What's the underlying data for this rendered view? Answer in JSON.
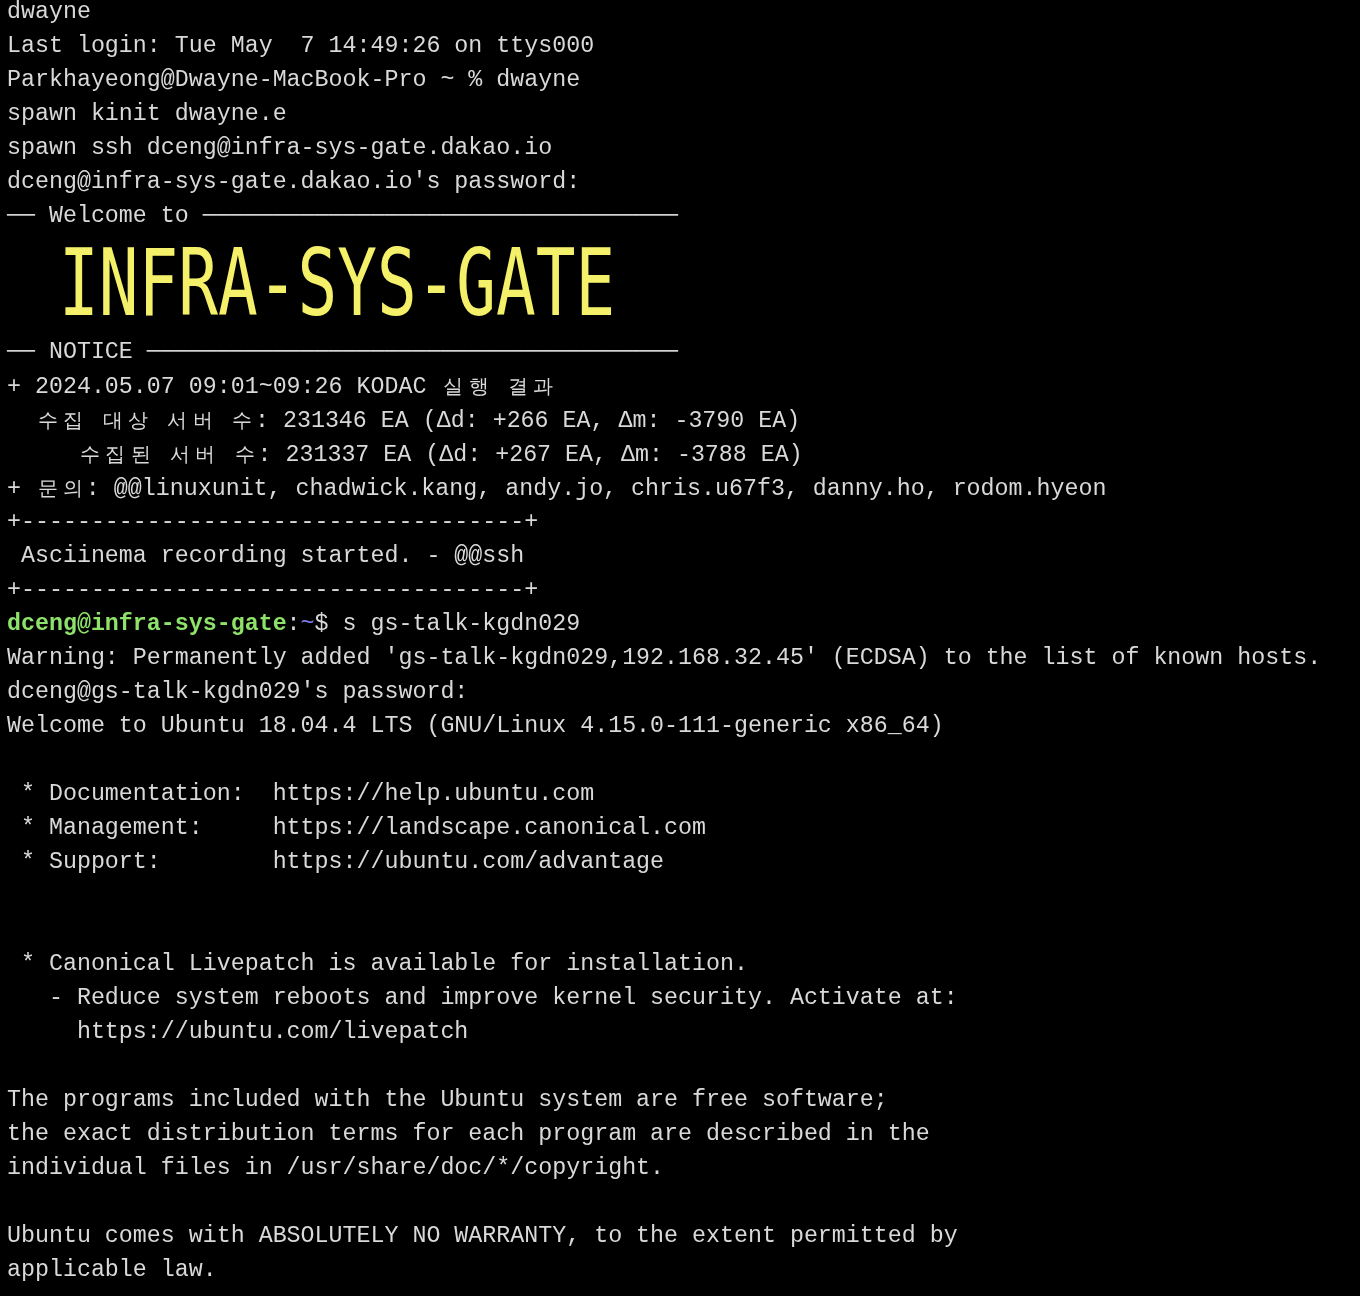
{
  "lines": [
    {
      "kind": "text",
      "text": "dwayne"
    },
    {
      "kind": "text",
      "text": "Last login: Tue May  7 14:49:26 on ttys000"
    },
    {
      "kind": "text",
      "text": "Parkhayeong@Dwayne-MacBook-Pro ~ % dwayne"
    },
    {
      "kind": "text",
      "text": "spawn kinit dwayne.e"
    },
    {
      "kind": "text",
      "text": "spawn ssh dceng@infra-sys-gate.dakao.io"
    },
    {
      "kind": "text",
      "text": "dceng@infra-sys-gate.dakao.io's password:"
    },
    {
      "kind": "text",
      "text": "── Welcome to ──────────────────────────────────"
    },
    {
      "kind": "banner",
      "text": "INFRA-SYS-GATE"
    },
    {
      "kind": "text",
      "text": "── NOTICE ──────────────────────────────────────"
    },
    {
      "kind": "text",
      "text": "+ 2024.05.07 09:01~09:26 KODAC 실행 결과"
    },
    {
      "kind": "text",
      "text": "  수집 대상 서버 수: 231346 EA (Δd: +266 EA, Δm: -3790 EA)"
    },
    {
      "kind": "text",
      "text": "     수집된 서버 수: 231337 EA (Δd: +267 EA, Δm: -3788 EA)"
    },
    {
      "kind": "text",
      "text": "+ 문의: @@linuxunit, chadwick.kang, andy.jo, chris.u67f3, danny.ho, rodom.hyeon"
    },
    {
      "kind": "text",
      "text": "+------------------------------------+"
    },
    {
      "kind": "text",
      "text": " Asciinema recording started. - @@ssh"
    },
    {
      "kind": "text",
      "text": "+------------------------------------+"
    },
    {
      "kind": "prompt",
      "user": "dceng@infra-sys-gate",
      "separator": ":",
      "path": "~",
      "command": "$ s gs-talk-kgdn029"
    },
    {
      "kind": "text",
      "text": "Warning: Permanently added 'gs-talk-kgdn029,192.168.32.45' (ECDSA) to the list of known hosts."
    },
    {
      "kind": "text",
      "text": "dceng@gs-talk-kgdn029's password:"
    },
    {
      "kind": "text",
      "text": "Welcome to Ubuntu 18.04.4 LTS (GNU/Linux 4.15.0-111-generic x86_64)"
    },
    {
      "kind": "blank"
    },
    {
      "kind": "text",
      "text": " * Documentation:  https://help.ubuntu.com"
    },
    {
      "kind": "text",
      "text": " * Management:     https://landscape.canonical.com"
    },
    {
      "kind": "text",
      "text": " * Support:        https://ubuntu.com/advantage"
    },
    {
      "kind": "blank"
    },
    {
      "kind": "blank"
    },
    {
      "kind": "text",
      "text": " * Canonical Livepatch is available for installation."
    },
    {
      "kind": "text",
      "text": "   - Reduce system reboots and improve kernel security. Activate at:"
    },
    {
      "kind": "text",
      "text": "     https://ubuntu.com/livepatch"
    },
    {
      "kind": "blank"
    },
    {
      "kind": "text",
      "text": "The programs included with the Ubuntu system are free software;"
    },
    {
      "kind": "text",
      "text": "the exact distribution terms for each program are described in the"
    },
    {
      "kind": "text",
      "text": "individual files in /usr/share/doc/*/copyright."
    },
    {
      "kind": "blank"
    },
    {
      "kind": "text",
      "text": "Ubuntu comes with ABSOLUTELY NO WARRANTY, to the extent permitted by"
    },
    {
      "kind": "text",
      "text": "applicable law."
    }
  ]
}
